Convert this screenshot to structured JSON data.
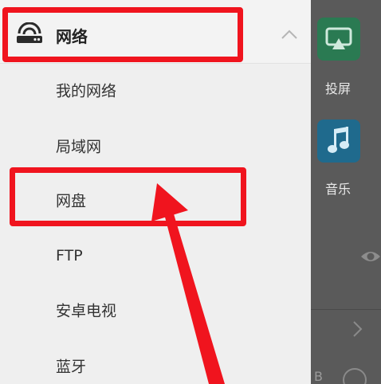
{
  "background": {
    "tiles": [
      {
        "label": "投屏",
        "icon": "cast-screen-icon",
        "color": "#2a7a52"
      },
      {
        "label": "音乐",
        "icon": "music-note-icon",
        "color": "#1f6a8d"
      }
    ],
    "partial_text": "B"
  },
  "drawer": {
    "header": {
      "title": "网络",
      "icon": "router-icon",
      "expanded_icon": "chevron-up-icon"
    },
    "items": [
      {
        "label": "我的网络"
      },
      {
        "label": "局域网"
      },
      {
        "label": "网盘"
      },
      {
        "label": "FTP"
      },
      {
        "label": "安卓电视"
      },
      {
        "label": "蓝牙"
      }
    ]
  },
  "annotation": {
    "color": "#f0141e"
  }
}
